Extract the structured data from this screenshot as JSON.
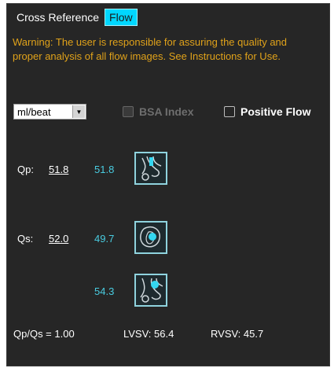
{
  "tabs": [
    {
      "label": "Cross Reference",
      "active": false
    },
    {
      "label": "Flow",
      "active": true
    }
  ],
  "warning": "Warning: The user is responsible for assuring the quality and proper analysis of all flow images. See Instructions for Use.",
  "units_select": {
    "value": "ml/beat"
  },
  "bsa_index": {
    "label": "BSA Index",
    "checked": false,
    "enabled": false
  },
  "positive_flow": {
    "label": "Positive Flow",
    "checked": false
  },
  "qp": {
    "label": "Qp:",
    "value": "51.8",
    "measurement": "51.8",
    "icon": "pulmonary-vessel-icon"
  },
  "qs": {
    "label": "Qs:",
    "value": "52.0",
    "measurement_1": "49.7",
    "measurement_2": "54.3",
    "icon_1": "aorta-vessel-icon",
    "icon_2": "aortic-arch-vessel-icon"
  },
  "summary": {
    "ratio": "Qp/Qs = 1.00",
    "lvsv": "LVSV: 56.4",
    "rvsv": "RVSV: 45.7"
  },
  "colors": {
    "accent": "#00d7ff",
    "warning": "#e0a21a",
    "value": "#49cce0",
    "panel": "#262626"
  }
}
